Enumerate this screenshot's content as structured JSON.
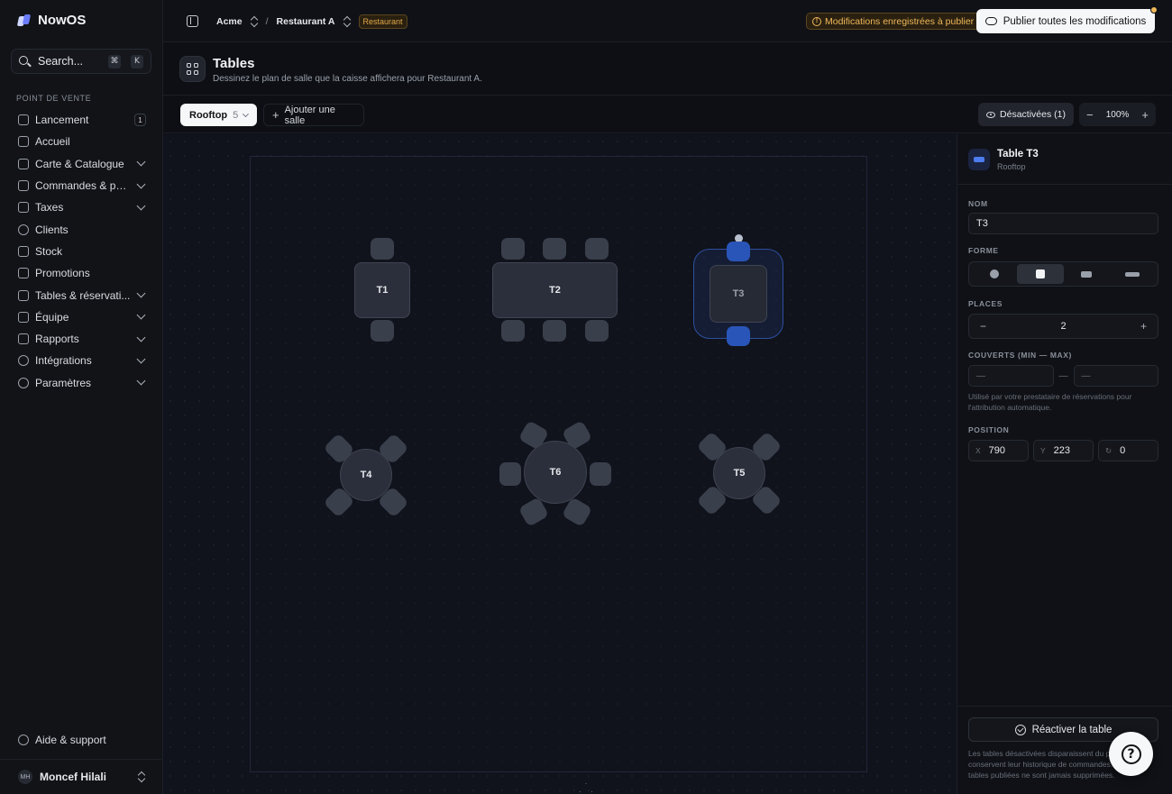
{
  "brand": {
    "name": "NowOS"
  },
  "sidebar": {
    "search_label": "Search...",
    "shortcut_keys": [
      "⌘",
      "K"
    ],
    "section_label": "POINT DE VENTE",
    "items": [
      {
        "label": "Lancement",
        "icon": "rocket-icon",
        "badge": "1"
      },
      {
        "label": "Accueil",
        "icon": "home-icon"
      },
      {
        "label": "Carte & Catalogue",
        "icon": "grid-icon",
        "expandable": true
      },
      {
        "label": "Commandes & pai...",
        "icon": "receipt-icon",
        "expandable": true
      },
      {
        "label": "Taxes",
        "icon": "document-icon",
        "expandable": true
      },
      {
        "label": "Clients",
        "icon": "users-icon"
      },
      {
        "label": "Stock",
        "icon": "box-icon"
      },
      {
        "label": "Promotions",
        "icon": "gift-icon"
      },
      {
        "label": "Tables & réservati...",
        "icon": "tables-icon",
        "expandable": true
      },
      {
        "label": "Équipe",
        "icon": "team-icon",
        "expandable": true
      },
      {
        "label": "Rapports",
        "icon": "chart-icon",
        "expandable": true
      },
      {
        "label": "Intégrations",
        "icon": "plug-icon",
        "expandable": true
      },
      {
        "label": "Paramètres",
        "icon": "gear-icon",
        "expandable": true
      }
    ],
    "help_label": "Aide & support",
    "user": {
      "initials": "MH",
      "name": "Moncef Hilali"
    }
  },
  "topbar": {
    "org": "Acme",
    "separator": "/",
    "location": "Restaurant A",
    "location_tag": "Restaurant",
    "pending_label": "Modifications enregistrées à publier",
    "publish_label": "Publier toutes les modifications"
  },
  "page": {
    "title": "Tables",
    "subtitle": "Dessinez le plan de salle que la caisse affichera pour Restaurant A."
  },
  "toolbar": {
    "room_name": "Rooftop",
    "room_count": "5",
    "add_room_label": "Ajouter une salle",
    "disabled_label": "Désactivées (1)",
    "zoom_minus": "−",
    "zoom_level": "100%",
    "zoom_plus": "+"
  },
  "floor": {
    "tables": [
      "T1",
      "T2",
      "T3",
      "T4",
      "T5",
      "T6"
    ],
    "selected": "T3"
  },
  "props": {
    "title": "Table T3",
    "room": "Rooftop",
    "name_label": "NOM",
    "name_value": "T3",
    "shape_label": "FORME",
    "shape_selected": "square",
    "seats_label": "PLACES",
    "seats_minus": "−",
    "seats_value": "2",
    "seats_plus": "+",
    "covers_label": "COUVERTS (MIN — MAX)",
    "covers_min_placeholder": "—",
    "covers_sep": "—",
    "covers_max_placeholder": "—",
    "covers_hint": "Utilisé par votre prestataire de réservations pour l'attribution automatique.",
    "position_label": "POSITION",
    "pos_x_label": "X",
    "pos_x": "790",
    "pos_y_label": "Y",
    "pos_y": "223",
    "pos_r_label": "↻",
    "pos_r": "0",
    "reactivate_label": "Réactiver la table",
    "footer_note": "Les tables désactivées disparaissent du plan mais conservent leur historique de commandes. Les tables publiées ne sont jamais supprimées."
  },
  "colors": {
    "accent": "#4c7cf0",
    "warning": "#f0b85a",
    "background": "#0d0f14"
  }
}
